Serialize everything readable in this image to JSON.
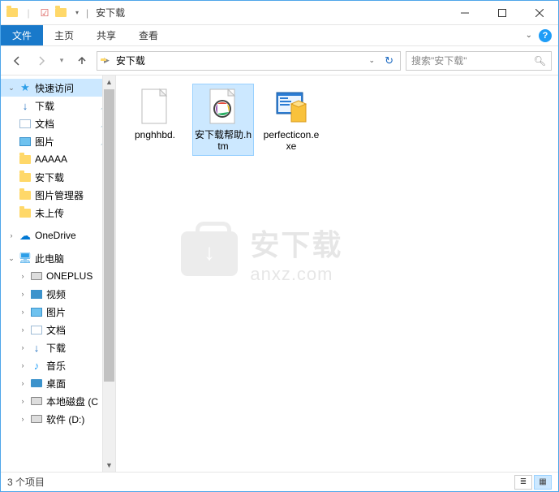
{
  "window": {
    "title": "安下载"
  },
  "ribbon": {
    "tabs": {
      "file": "文件",
      "home": "主页",
      "share": "共享",
      "view": "查看"
    }
  },
  "nav": {
    "breadcrumb": "安下载",
    "search_placeholder": "搜索\"安下载\""
  },
  "sidebar": {
    "quick_access": "快速访问",
    "items": [
      {
        "label": "下载",
        "icon": "download",
        "pinned": true
      },
      {
        "label": "文档",
        "icon": "document",
        "pinned": true
      },
      {
        "label": "图片",
        "icon": "picture",
        "pinned": true
      },
      {
        "label": "AAAAA",
        "icon": "folder",
        "pinned": false
      },
      {
        "label": "安下载",
        "icon": "folder",
        "pinned": false
      },
      {
        "label": "图片管理器",
        "icon": "folder",
        "pinned": false
      },
      {
        "label": "未上传",
        "icon": "folder",
        "pinned": false
      }
    ],
    "onedrive": "OneDrive",
    "this_pc": "此电脑",
    "pc_items": [
      {
        "label": "ONEPLUS",
        "icon": "device"
      },
      {
        "label": "视频",
        "icon": "video"
      },
      {
        "label": "图片",
        "icon": "picture"
      },
      {
        "label": "文档",
        "icon": "document"
      },
      {
        "label": "下载",
        "icon": "download"
      },
      {
        "label": "音乐",
        "icon": "music"
      },
      {
        "label": "桌面",
        "icon": "desktop"
      },
      {
        "label": "本地磁盘 (C",
        "icon": "disk"
      },
      {
        "label": "软件 (D:)",
        "icon": "disk"
      }
    ]
  },
  "files": [
    {
      "name": "pnghhbd.",
      "type": "file"
    },
    {
      "name": "安下载帮助.htm",
      "type": "htm"
    },
    {
      "name": "perfecticon.exe",
      "type": "exe"
    }
  ],
  "status": {
    "count_text": "3 个项目"
  },
  "watermark": {
    "cn": "安下载",
    "en": "anxz.com"
  }
}
